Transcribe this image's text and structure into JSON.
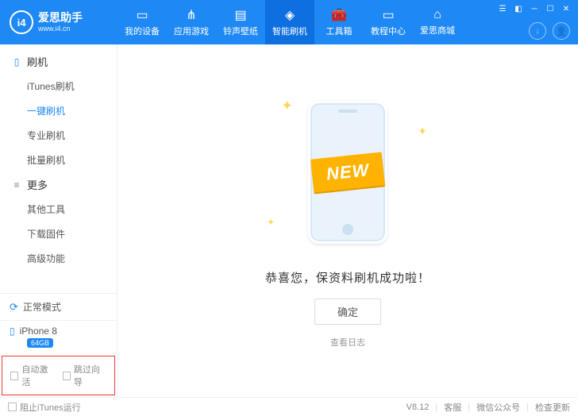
{
  "brand": {
    "title": "爱思助手",
    "subtitle": "www.i4.cn",
    "logo_text": "i4"
  },
  "nav": {
    "items": [
      {
        "label": "我的设备"
      },
      {
        "label": "应用游戏"
      },
      {
        "label": "铃声壁纸"
      },
      {
        "label": "智能刷机"
      },
      {
        "label": "工具箱"
      },
      {
        "label": "教程中心"
      },
      {
        "label": "爱思商城"
      }
    ],
    "active_index": 3
  },
  "sidebar": {
    "groups": [
      {
        "title": "刷机",
        "items": [
          "iTunes刷机",
          "一键刷机",
          "专业刷机",
          "批量刷机"
        ],
        "active_index": 1
      },
      {
        "title": "更多",
        "items": [
          "其他工具",
          "下载固件",
          "高级功能"
        ],
        "active_index": -1
      }
    ],
    "status_mode": "正常模式",
    "device_name": "iPhone 8",
    "device_storage": "64GB",
    "check_auto_activate": "自动激活",
    "check_skip_guide": "跳过向导"
  },
  "main": {
    "ribbon_text": "NEW",
    "message": "恭喜您，保资料刷机成功啦！",
    "ok_button": "确定",
    "view_log": "查看日志"
  },
  "footer": {
    "block_itunes": "阻止iTunes运行",
    "version": "V8.12",
    "support": "客服",
    "wechat": "微信公众号",
    "check_update": "检查更新"
  }
}
